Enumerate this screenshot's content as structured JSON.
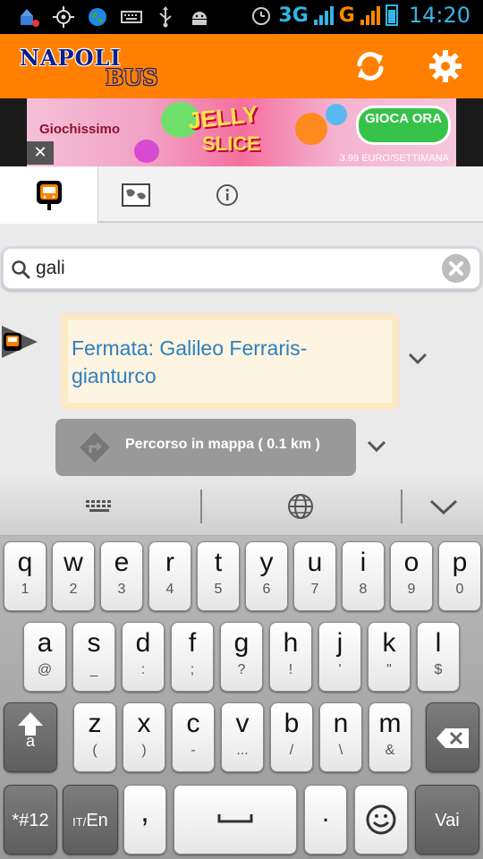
{
  "status_bar": {
    "network1": "3G",
    "network2": "G",
    "time": "14:20",
    "icons": [
      "cleaner-icon",
      "gps-icon",
      "globe-icon",
      "keyboard-icon",
      "usb-icon",
      "android-icon",
      "alarm-icon",
      "battery-icon"
    ]
  },
  "app_bar": {
    "logo_line1": "NAPOLI",
    "logo_line2": "BUS",
    "actions": [
      "refresh-icon",
      "settings-icon"
    ],
    "accent_color": "#ff8000"
  },
  "ad": {
    "brand": "Giochissimo",
    "title_line1": "JELLY",
    "title_line2": "SLICE",
    "cta": "GIOCA ORA",
    "price": "3.99 EURO/SETTIMANA",
    "close": "✕"
  },
  "tabs": [
    {
      "icon": "bus-stop-icon",
      "active": true
    },
    {
      "icon": "map-icon",
      "active": false
    },
    {
      "icon": "info-icon",
      "active": false
    }
  ],
  "search": {
    "value": "gali",
    "placeholder": ""
  },
  "result": {
    "title": "Fermata: Galileo Ferraris-gianturco",
    "route_button": "Percorso in mappa ( 0.1 km )"
  },
  "keyboard": {
    "row1": [
      {
        "k": "q",
        "s": "1"
      },
      {
        "k": "w",
        "s": "2"
      },
      {
        "k": "e",
        "s": "3"
      },
      {
        "k": "r",
        "s": "4"
      },
      {
        "k": "t",
        "s": "5"
      },
      {
        "k": "y",
        "s": "6"
      },
      {
        "k": "u",
        "s": "7"
      },
      {
        "k": "i",
        "s": "8"
      },
      {
        "k": "o",
        "s": "9"
      },
      {
        "k": "p",
        "s": "0"
      }
    ],
    "row2": [
      {
        "k": "a",
        "s": "@"
      },
      {
        "k": "s",
        "s": "_"
      },
      {
        "k": "d",
        "s": ":"
      },
      {
        "k": "f",
        "s": ";"
      },
      {
        "k": "g",
        "s": "?"
      },
      {
        "k": "h",
        "s": "!"
      },
      {
        "k": "j",
        "s": "'"
      },
      {
        "k": "k",
        "s": "\""
      },
      {
        "k": "l",
        "s": "$"
      }
    ],
    "row3": [
      {
        "k": "z",
        "s": "("
      },
      {
        "k": "x",
        "s": ")"
      },
      {
        "k": "c",
        "s": "-"
      },
      {
        "k": "v",
        "s": "..."
      },
      {
        "k": "b",
        "s": "/"
      },
      {
        "k": "n",
        "s": "\\"
      },
      {
        "k": "m",
        "s": "&"
      }
    ],
    "shift_sub": "a",
    "symbols": "*#12",
    "lang": "IT/En",
    "lang_main": "En",
    "lang_prefix": "IT/",
    "comma": ",",
    "space": "",
    "period": ".",
    "go": "Vai"
  }
}
